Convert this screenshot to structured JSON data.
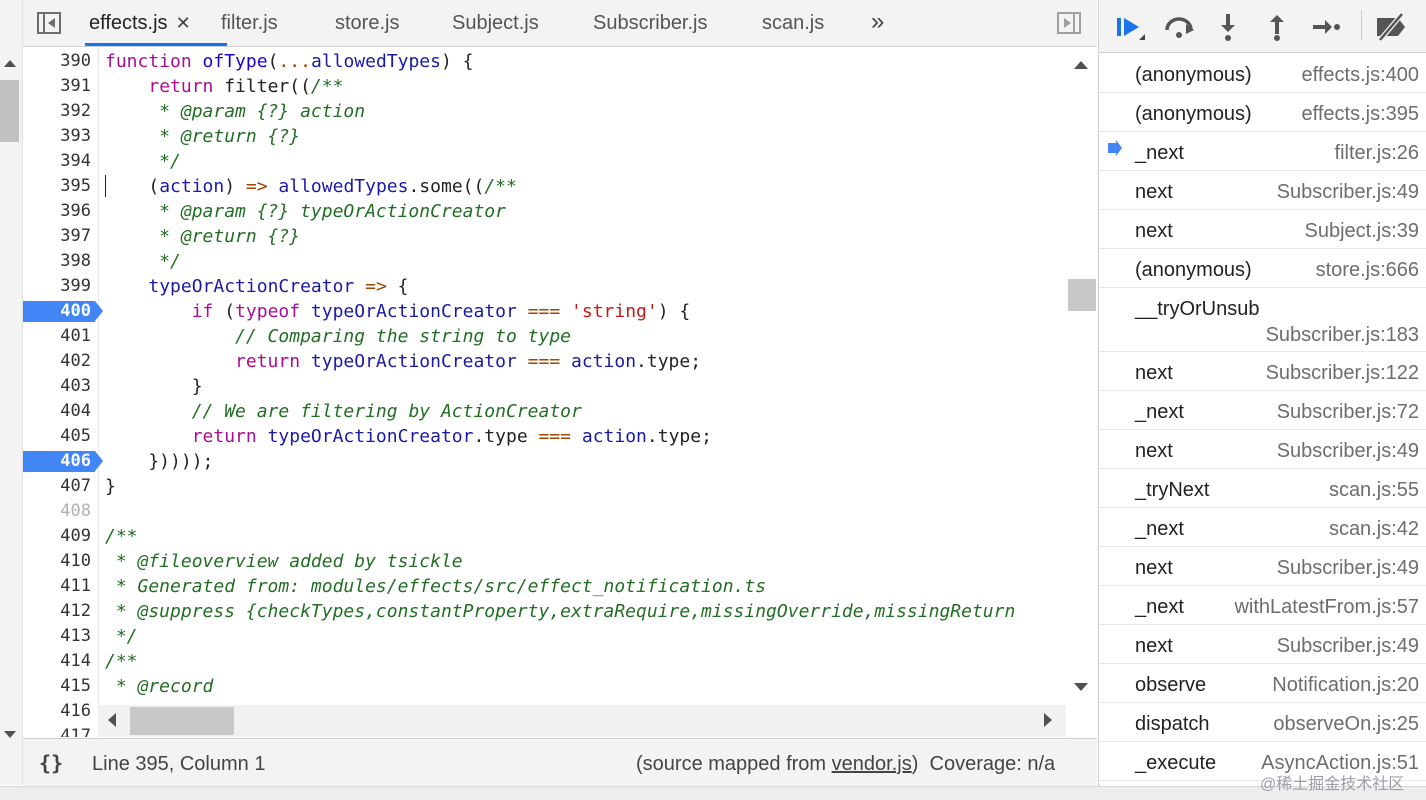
{
  "tabs": [
    {
      "label": "effects.js",
      "active": true,
      "close": "✕"
    },
    {
      "label": "filter.js"
    },
    {
      "label": "store.js"
    },
    {
      "label": "Subject.js"
    },
    {
      "label": "Subscriber.js"
    },
    {
      "label": "scan.js"
    }
  ],
  "more_tabs": "»",
  "code": {
    "breakpoints": [
      400,
      406
    ],
    "current_line": 395,
    "lines": [
      {
        "n": "390",
        "dim": false
      },
      {
        "n": "391",
        "dim": false
      },
      {
        "n": "392",
        "dim": false
      },
      {
        "n": "393",
        "dim": false
      },
      {
        "n": "394",
        "dim": false
      },
      {
        "n": "395",
        "dim": false
      },
      {
        "n": "396",
        "dim": false
      },
      {
        "n": "397",
        "dim": false
      },
      {
        "n": "398",
        "dim": false
      },
      {
        "n": "399",
        "dim": false
      },
      {
        "n": "400",
        "dim": false
      },
      {
        "n": "401",
        "dim": false
      },
      {
        "n": "402",
        "dim": false
      },
      {
        "n": "403",
        "dim": false
      },
      {
        "n": "404",
        "dim": false
      },
      {
        "n": "405",
        "dim": false
      },
      {
        "n": "406",
        "dim": false
      },
      {
        "n": "407",
        "dim": false
      },
      {
        "n": "408",
        "dim": true
      },
      {
        "n": "409",
        "dim": false
      },
      {
        "n": "410",
        "dim": false
      },
      {
        "n": "411",
        "dim": false
      },
      {
        "n": "412",
        "dim": false
      },
      {
        "n": "413",
        "dim": false
      },
      {
        "n": "414",
        "dim": false
      },
      {
        "n": "415",
        "dim": false
      },
      {
        "n": "416",
        "dim": false
      },
      {
        "n": "417",
        "dim": false
      }
    ],
    "tokens": [
      [
        [
          "kw",
          "function "
        ],
        [
          "fn",
          "ofType"
        ],
        [
          "",
          "("
        ],
        [
          "op",
          "..."
        ],
        [
          "id",
          "allowedTypes"
        ],
        [
          "",
          ") {"
        ]
      ],
      [
        [
          "",
          "    "
        ],
        [
          "kw",
          "return "
        ],
        [
          "",
          "filter(("
        ],
        [
          "cm",
          "/**"
        ]
      ],
      [
        [
          "cm",
          "     * @param {?} action"
        ]
      ],
      [
        [
          "cm",
          "     * @return {?}"
        ]
      ],
      [
        [
          "cm",
          "     */"
        ]
      ],
      [
        [
          "",
          "    ("
        ],
        [
          "id",
          "action"
        ],
        [
          "",
          ") "
        ],
        [
          "op",
          "=> "
        ],
        [
          "id",
          "allowedTypes"
        ],
        [
          "",
          ".some(("
        ],
        [
          "cm",
          "/**"
        ]
      ],
      [
        [
          "cm",
          "     * @param {?} typeOrActionCreator"
        ]
      ],
      [
        [
          "cm",
          "     * @return {?}"
        ]
      ],
      [
        [
          "cm",
          "     */"
        ]
      ],
      [
        [
          "",
          "    "
        ],
        [
          "id",
          "typeOrActionCreator "
        ],
        [
          "op",
          "=> "
        ],
        [
          "",
          "{"
        ]
      ],
      [
        [
          "",
          "        "
        ],
        [
          "kw",
          "if "
        ],
        [
          "",
          "("
        ],
        [
          "kw",
          "typeof "
        ],
        [
          "id",
          "typeOrActionCreator "
        ],
        [
          "op",
          "=== "
        ],
        [
          "str",
          "'string'"
        ],
        [
          "",
          ") {"
        ]
      ],
      [
        [
          "",
          "            "
        ],
        [
          "cm",
          "// Comparing the string to type"
        ]
      ],
      [
        [
          "",
          "            "
        ],
        [
          "kw",
          "return "
        ],
        [
          "id",
          "typeOrActionCreator "
        ],
        [
          "op",
          "=== "
        ],
        [
          "id",
          "action"
        ],
        [
          "",
          ".type;"
        ]
      ],
      [
        [
          "",
          "        }"
        ]
      ],
      [
        [
          "",
          "        "
        ],
        [
          "cm",
          "// We are filtering by ActionCreator"
        ]
      ],
      [
        [
          "",
          "        "
        ],
        [
          "kw",
          "return "
        ],
        [
          "id",
          "typeOrActionCreator"
        ],
        [
          "",
          ".type "
        ],
        [
          "op",
          "=== "
        ],
        [
          "id",
          "action"
        ],
        [
          "",
          ".type;"
        ]
      ],
      [
        [
          "",
          "    }))));"
        ]
      ],
      [
        [
          "",
          "}"
        ]
      ],
      [
        [
          "",
          ""
        ]
      ],
      [
        [
          "cm",
          "/**"
        ]
      ],
      [
        [
          "cm",
          " * @fileoverview added by tsickle"
        ]
      ],
      [
        [
          "cm",
          " * Generated from: modules/effects/src/effect_notification.ts"
        ]
      ],
      [
        [
          "cm",
          " * @suppress {checkTypes,constantProperty,extraRequire,missingOverride,missingReturn"
        ]
      ],
      [
        [
          "cm",
          " */"
        ]
      ],
      [
        [
          "cm",
          "/**"
        ]
      ],
      [
        [
          "cm",
          " * @record"
        ]
      ],
      [
        [
          "",
          ""
        ]
      ],
      [
        [
          "",
          ""
        ]
      ]
    ]
  },
  "status": {
    "braces": "{}",
    "position": "Line 395, Column 1",
    "mapped_prefix": "(source mapped from ",
    "mapped_link": "vendor.js",
    "mapped_suffix": ")",
    "coverage": "Coverage: n/a"
  },
  "debug_toolbar": {
    "icons": [
      "resume-icon",
      "step-over-icon",
      "step-into-icon",
      "step-out-icon",
      "step-icon",
      "deactivate-breakpoints-icon"
    ],
    "accent": "#1a73e8"
  },
  "call_stack": [
    {
      "name": "(anonymous)",
      "loc": "effects.js:400",
      "current": false
    },
    {
      "name": "(anonymous)",
      "loc": "effects.js:395",
      "current": false
    },
    {
      "name": "_next",
      "loc": "filter.js:26",
      "current": true
    },
    {
      "name": "next",
      "loc": "Subscriber.js:49",
      "current": false
    },
    {
      "name": "next",
      "loc": "Subject.js:39",
      "current": false
    },
    {
      "name": "(anonymous)",
      "loc": "store.js:666",
      "current": false
    },
    {
      "name": "__tryOrUnsub",
      "loc": "Subscriber.js:183",
      "current": false,
      "wrap": true
    },
    {
      "name": "next",
      "loc": "Subscriber.js:122",
      "current": false
    },
    {
      "name": "_next",
      "loc": "Subscriber.js:72",
      "current": false
    },
    {
      "name": "next",
      "loc": "Subscriber.js:49",
      "current": false
    },
    {
      "name": "_tryNext",
      "loc": "scan.js:55",
      "current": false
    },
    {
      "name": "_next",
      "loc": "scan.js:42",
      "current": false
    },
    {
      "name": "next",
      "loc": "Subscriber.js:49",
      "current": false
    },
    {
      "name": "_next",
      "loc": "withLatestFrom.js:57",
      "current": false
    },
    {
      "name": "next",
      "loc": "Subscriber.js:49",
      "current": false
    },
    {
      "name": "observe",
      "loc": "Notification.js:20",
      "current": false
    },
    {
      "name": "dispatch",
      "loc": "observeOn.js:25",
      "current": false
    },
    {
      "name": "_execute",
      "loc": "AsyncAction.js:51",
      "current": false
    }
  ],
  "watermark": "@稀土掘金技术社区"
}
